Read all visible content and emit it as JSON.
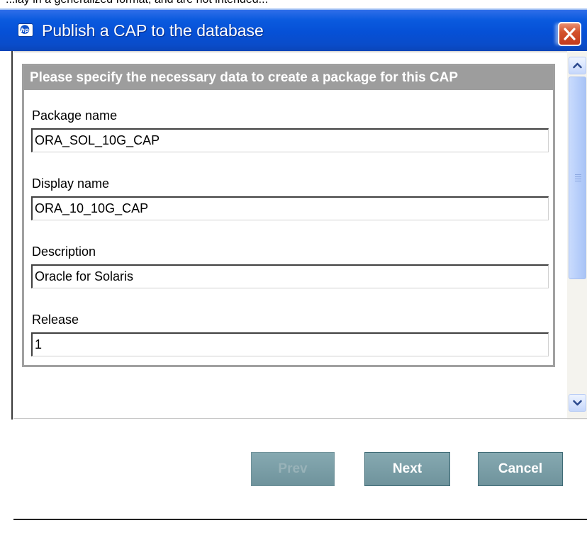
{
  "window": {
    "caption_fragment": "...lay in a generalized format, and are not intended...",
    "title": "Publish a CAP to the database",
    "icon": "hp-logo-icon",
    "close_icon": "close-icon"
  },
  "panel": {
    "header": "Please specify the necessary data to create a package for this CAP",
    "fields": [
      {
        "label": "Package name",
        "value": "ORA_SOL_10G_CAP"
      },
      {
        "label": "Display name",
        "value": "ORA_10_10G_CAP"
      },
      {
        "label": "Description",
        "value": "Oracle for Solaris"
      },
      {
        "label": "Release",
        "value": "1"
      }
    ]
  },
  "scrollbar": {
    "up_icon": "chevron-up-icon",
    "down_icon": "chevron-down-icon"
  },
  "buttons": {
    "prev": "Prev",
    "next": "Next",
    "cancel": "Cancel"
  },
  "colors": {
    "titlebar": "#0650d6",
    "close": "#d4532d",
    "panel_header": "#9d9d9d",
    "button": "#7b9ea7"
  }
}
